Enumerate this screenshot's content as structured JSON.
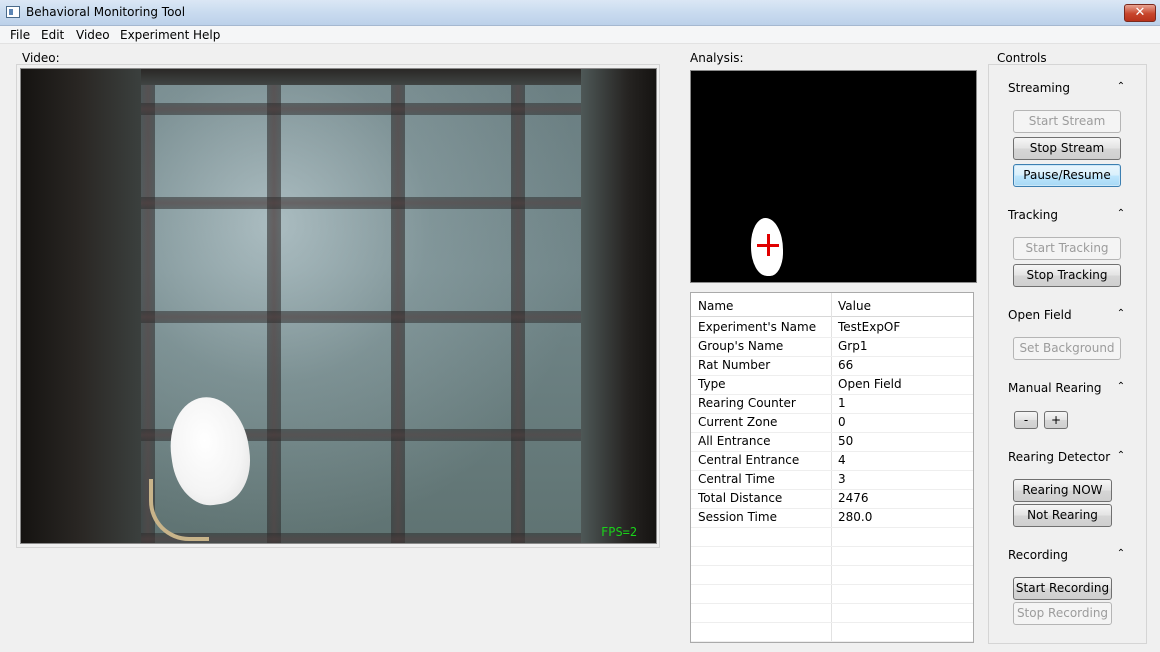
{
  "window": {
    "title": "Behavioral Monitoring Tool",
    "close_label": "✕"
  },
  "menu": [
    "File",
    "Edit",
    "Video",
    "Experiment",
    "Help"
  ],
  "video": {
    "label": "Video:",
    "fps_text": "FPS=2"
  },
  "analysis": {
    "label": "Analysis:",
    "table": {
      "headers": [
        "Name",
        "Value"
      ],
      "rows": [
        [
          "Experiment's Name",
          "TestExpOF"
        ],
        [
          "Group's Name",
          "Grp1"
        ],
        [
          "Rat Number",
          "66"
        ],
        [
          "Type",
          "Open Field"
        ],
        [
          "Rearing Counter",
          "1"
        ],
        [
          "Current Zone",
          "0"
        ],
        [
          "All Entrance",
          "50"
        ],
        [
          "Central Entrance",
          "4"
        ],
        [
          "Central Time",
          "3"
        ],
        [
          "Total Distance",
          "2476"
        ],
        [
          "Session Time",
          "280.0"
        ]
      ]
    }
  },
  "controls": {
    "label": "Controls",
    "collapse_icon": "⌃",
    "streaming": {
      "title": "Streaming",
      "start": "Start Stream",
      "stop": "Stop Stream",
      "pause": "Pause/Resume"
    },
    "tracking": {
      "title": "Tracking",
      "start": "Start Tracking",
      "stop": "Stop Tracking"
    },
    "open_field": {
      "title": "Open Field",
      "set_background": "Set Background"
    },
    "manual_rearing": {
      "title": "Manual Rearing",
      "minus": "-",
      "plus": "+"
    },
    "rearing_detector": {
      "title": "Rearing Detector",
      "now": "Rearing NOW",
      "not": "Not Rearing"
    },
    "recording": {
      "title": "Recording",
      "start": "Start Recording",
      "stop": "Stop Recording"
    }
  },
  "colors": {
    "fps_green": "#19d219",
    "tracking_cross": "#e00000",
    "focus_blue": "#3c7fb1"
  }
}
